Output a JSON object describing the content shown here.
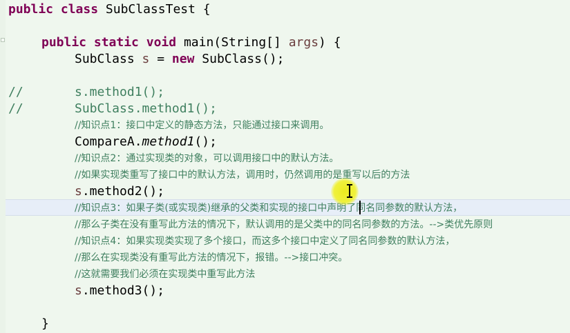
{
  "code": {
    "line1": {
      "kw1": "public",
      "kw2": "class",
      "name": "SubClassTest {"
    },
    "line2": {
      "kw1": "public",
      "kw2": "static",
      "kw3": "void",
      "sig": "main(String[]",
      "param": "args",
      "tail": ") {"
    },
    "line3": {
      "t1": "SubClass",
      "var": "s",
      "t2": "=",
      "kw": "new",
      "t3": "SubClass();"
    },
    "line4": {
      "marker": "//",
      "code": "s.method1();"
    },
    "line5": {
      "marker": "//",
      "code": "SubClass.method1();"
    },
    "line6": {
      "comment": "//知识点1：接口中定义的静态方法，只能通过接口来调用。"
    },
    "line7": {
      "obj": "CompareA.",
      "method": "method1",
      "tail": "();"
    },
    "line8": {
      "comment": "//知识点2：通过实现类的对象，可以调用接口中的默认方法。"
    },
    "line9": {
      "comment": "//如果实现类重写了接口中的默认方法，调用时，仍然调用的是重写以后的方法"
    },
    "line10": {
      "var": "s",
      "tail": ".method2();"
    },
    "line11": {
      "comment": "//知识点3：如果子类(或实现类)继承的父类和实现的接口中声明了同名同参数的默认方法，"
    },
    "line12": {
      "comment": "//那么子类在没有重写此方法的情况下，默认调用的是父类中的同名同参数的方法。-->类优先原则"
    },
    "line13": {
      "comment": "//知识点4：如果实现类实现了多个接口，而这多个接口中定义了同名同参数的默认方法，"
    },
    "line14": {
      "comment": "//那么在实现类没有重写此方法的情况下，报错。-->接口冲突。"
    },
    "line15": {
      "comment": "//这就需要我们必须在实现类中重写此方法"
    },
    "line16": {
      "var": "s",
      "tail": ".method3();"
    },
    "line17": {
      "brace": "}"
    }
  },
  "colors": {
    "background": "#eff7ee",
    "keyword": "#7f0055",
    "comment": "#3f7f5f",
    "variable": "#6a3e3e",
    "current_line": "#e7eef8",
    "pointer_highlight": "#ecec1e"
  }
}
